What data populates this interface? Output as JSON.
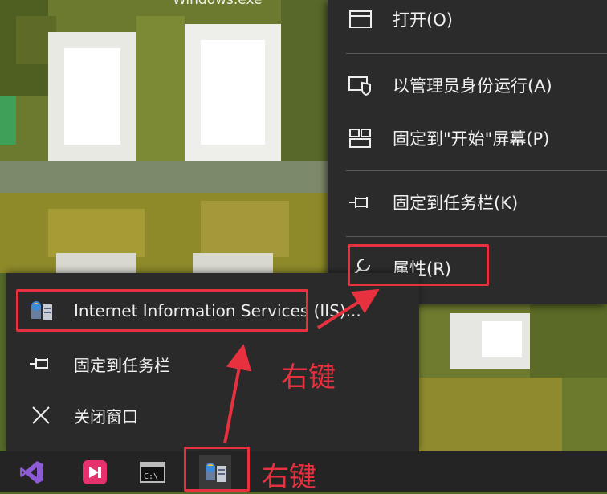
{
  "window_title_fragment": "Windows.exe",
  "context_menu": {
    "items": [
      {
        "label": "打开(O)",
        "icon": "window-icon"
      },
      {
        "label": "以管理员身份运行(A)",
        "icon": "shield-run-icon"
      },
      {
        "label": "固定到\"开始\"屏幕(P)",
        "icon": "tiles-icon"
      },
      {
        "label": "固定到任务栏(K)",
        "icon": "pin-icon"
      },
      {
        "label": "属性(R)",
        "icon": "wrench-icon"
      }
    ]
  },
  "jump_list": {
    "app_label": "Internet Information Services (IIS)...",
    "pin_label": "固定到任务栏",
    "close_label": "关闭窗口"
  },
  "taskbar": {
    "icons": [
      "visual-studio-icon",
      "app-pink-icon",
      "cmd-icon",
      "iis-manager-icon"
    ]
  },
  "annotations": {
    "right_click_1": "右键",
    "right_click_2": "右键"
  },
  "colors": {
    "annotation": "#e8313e",
    "menu_bg": "#2b2b2b",
    "taskbar_bg": "#242424"
  }
}
